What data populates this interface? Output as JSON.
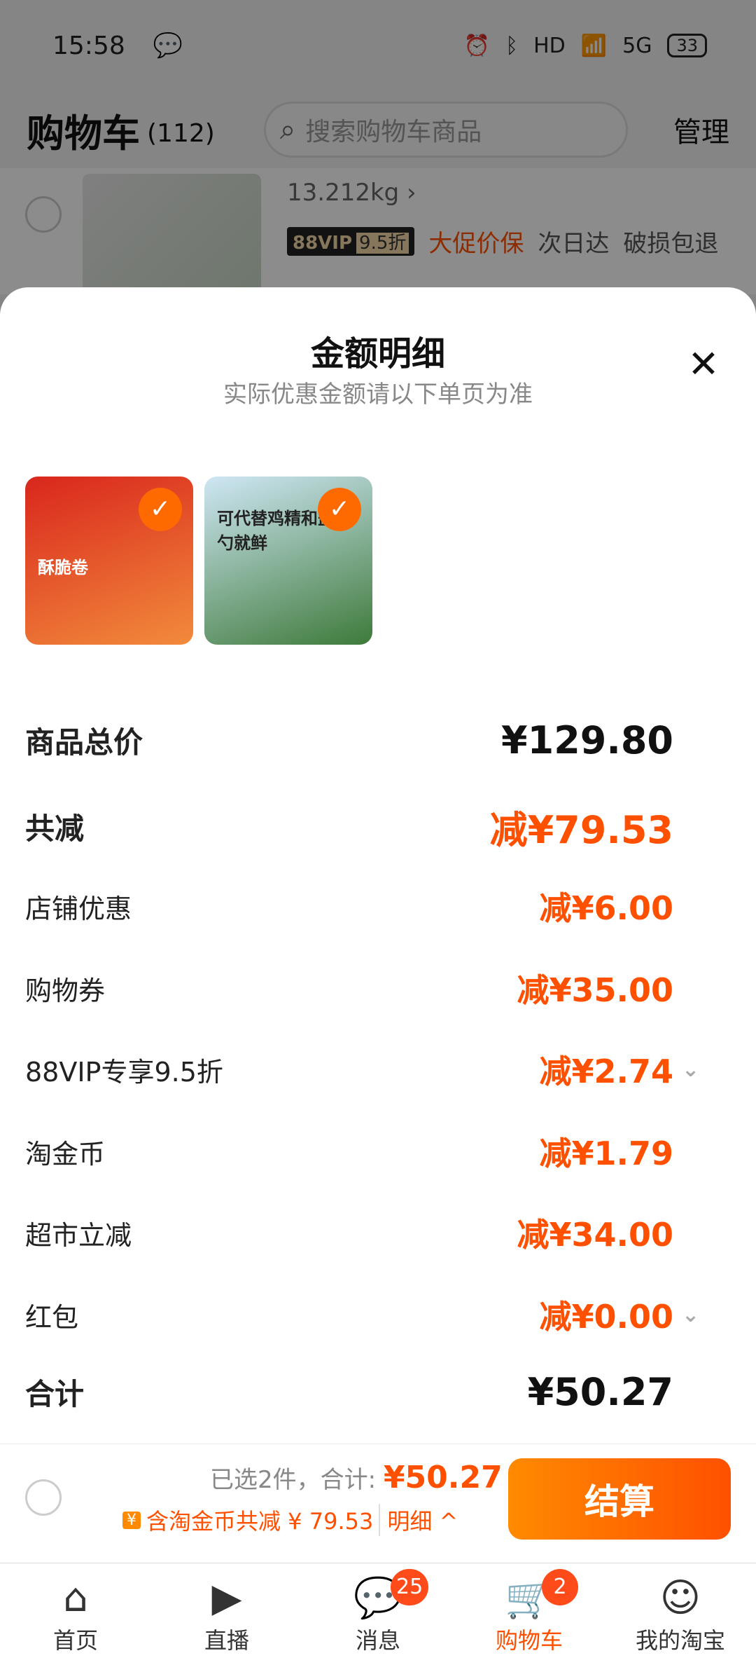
{
  "status_bar": {
    "time": "15:58",
    "battery": "33",
    "network": "5G",
    "hd": "HD"
  },
  "cart": {
    "title": "购物车",
    "count": "(112)",
    "search_placeholder": "搜索购物车商品",
    "manage": "管理",
    "item": {
      "spec": "13.212kg ›",
      "vip_label": "88VIP",
      "vip_discount": "9.5折",
      "tags": [
        "大促价保",
        "次日达",
        "破损包退"
      ]
    }
  },
  "sheet": {
    "title": "金额明细",
    "subtitle": "实际优惠金额请以下单页为准",
    "products": [
      {
        "label": "酥脆卷",
        "icon": "check-icon"
      },
      {
        "label": "可代替鸡精和盐 一勺就鲜",
        "icon": "check-icon"
      }
    ],
    "rows": [
      {
        "label": "商品总价",
        "amount": "¥129.80"
      },
      {
        "label": "共减",
        "amount": "减¥79.53"
      },
      {
        "label": "店铺优惠",
        "amount": "减¥6.00"
      },
      {
        "label": "购物券",
        "amount": "减¥35.00"
      },
      {
        "label": "88VIP专享9.5折",
        "amount": "减¥2.74"
      },
      {
        "label": "淘金币",
        "amount": "减¥1.79"
      },
      {
        "label": "超市立减",
        "amount": "减¥34.00"
      },
      {
        "label": "红包",
        "amount": "减¥0.00"
      },
      {
        "label": "合计",
        "amount": "¥50.27"
      }
    ]
  },
  "bottom": {
    "selected_text": "已选2件，合计:",
    "total": "¥50.27",
    "coin_text": "含淘金币共减 ¥ 79.53",
    "detail": "明细 ^",
    "checkout": "结算"
  },
  "tabs": [
    {
      "label": "首页",
      "icon": "home-icon"
    },
    {
      "label": "直播",
      "icon": "live-icon"
    },
    {
      "label": "消息",
      "icon": "message-icon",
      "badge": "25"
    },
    {
      "label": "购物车",
      "icon": "cart-icon",
      "badge": "2"
    },
    {
      "label": "我的淘宝",
      "icon": "profile-icon"
    }
  ],
  "colors": {
    "accent": "#ff5000",
    "overlay": "rgba(0,0,0,0.45)"
  }
}
